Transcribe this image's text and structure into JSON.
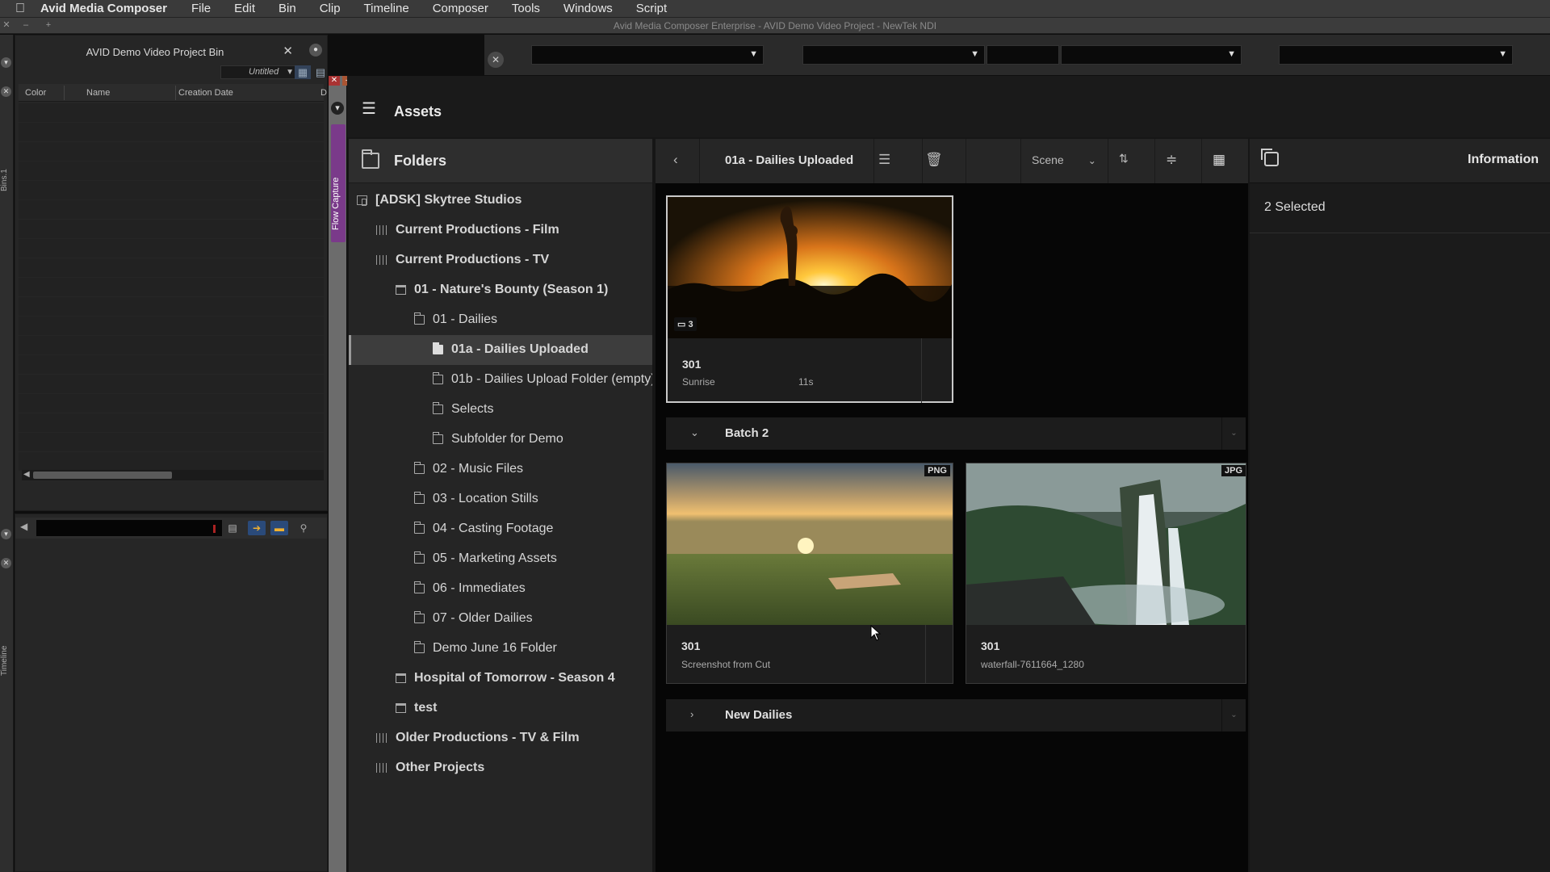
{
  "menubar": {
    "app": "Avid Media Composer",
    "items": [
      "File",
      "Edit",
      "Bin",
      "Clip",
      "Timeline",
      "Composer",
      "Tools",
      "Windows",
      "Script"
    ]
  },
  "window": {
    "title": "Avid Media Composer Enterprise - AVID Demo Video Project - NewTek NDI"
  },
  "side_labels": {
    "bins": "Bins.1",
    "timeline": "Timeline"
  },
  "bin": {
    "title": "AVID Demo Video Project Bin",
    "view_name": "Untitled",
    "columns": [
      "Color",
      "Name",
      "Creation Date",
      "D"
    ]
  },
  "flow_capture_tab": "Flow Capture",
  "assets": {
    "title": "Assets"
  },
  "folders": {
    "title": "Folders",
    "tree": [
      {
        "label": "[ADSK] Skytree Studios",
        "icon": "studio-icon"
      },
      {
        "label": "Current Productions - Film",
        "icon": "library-icon"
      },
      {
        "label": "Current Productions - TV",
        "icon": "library-icon"
      },
      {
        "label": "01 - Nature's Bounty (Season 1)",
        "icon": "project-icon"
      },
      {
        "label": "01 - Dailies",
        "icon": "folder-icon"
      },
      {
        "label": "01a - Dailies Uploaded",
        "icon": "folder-icon",
        "selected": true
      },
      {
        "label": "01b - Dailies Upload Folder (empty)",
        "icon": "folder-icon"
      },
      {
        "label": "Selects",
        "icon": "folder-icon"
      },
      {
        "label": "Subfolder for Demo",
        "icon": "folder-icon"
      },
      {
        "label": "02 - Music Files",
        "icon": "folder-icon"
      },
      {
        "label": "03 - Location Stills",
        "icon": "folder-icon"
      },
      {
        "label": "04 - Casting Footage",
        "icon": "folder-icon"
      },
      {
        "label": "05 - Marketing Assets",
        "icon": "folder-icon"
      },
      {
        "label": "06 - Immediates",
        "icon": "folder-icon"
      },
      {
        "label": "07 - Older Dailies",
        "icon": "folder-icon"
      },
      {
        "label": "Demo June 16 Folder",
        "icon": "folder-icon"
      },
      {
        "label": "Hospital of Tomorrow - Season 4",
        "icon": "project-icon"
      },
      {
        "label": "test",
        "icon": "project-icon"
      },
      {
        "label": "Older Productions - TV & Film",
        "icon": "library-icon"
      },
      {
        "label": "Other Projects",
        "icon": "library-icon"
      }
    ]
  },
  "grid": {
    "current_folder": "01a - Dailies Uploaded",
    "sort_by": "Scene",
    "cards_top": [
      {
        "title": "301",
        "subtitle": "Sunrise",
        "duration": "11s",
        "comments": "3"
      }
    ],
    "groups": [
      {
        "title": "Batch 2",
        "expanded": true
      },
      {
        "title": "New Dailies",
        "expanded": false
      }
    ],
    "batch2_cards": [
      {
        "title": "301",
        "subtitle": "Screenshot from Cut",
        "badge": "PNG"
      },
      {
        "title": "301",
        "subtitle": "waterfall-7611664_1280",
        "badge": "JPG"
      }
    ]
  },
  "info": {
    "title": "Information",
    "selected": "2 Selected"
  }
}
